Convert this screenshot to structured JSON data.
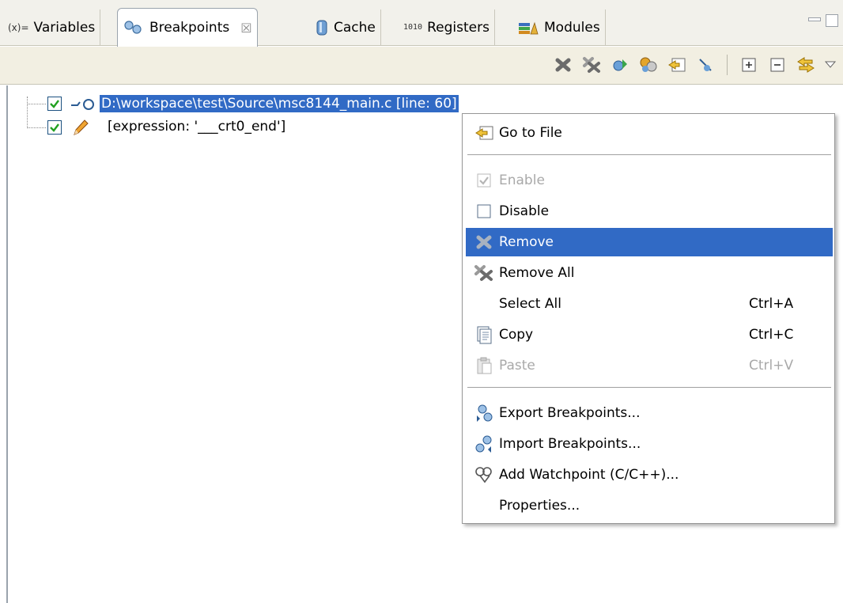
{
  "tabs": [
    {
      "icon": "variables-icon",
      "label": "Variables",
      "prefix": "(x)="
    },
    {
      "icon": "breakpoints-icon",
      "label": "Breakpoints",
      "close": "☒"
    },
    {
      "icon": "cache-icon",
      "label": "Cache"
    },
    {
      "icon": "registers-icon",
      "label": "Registers",
      "prefix": "1010"
    },
    {
      "icon": "modules-icon",
      "label": "Modules"
    }
  ],
  "toolbar": {
    "items": [
      "remove-icon",
      "remove-all-icon",
      "show-breakpoints-supported-icon",
      "skip-all-icon",
      "go-to-file-icon",
      "link-with-debug-view-icon",
      "expand-all-icon",
      "collapse-all-icon",
      "link-icon",
      "view-menu-icon"
    ]
  },
  "tree": {
    "items": [
      {
        "checked": true,
        "label": "D:\\workspace\\test\\Source\\msc8144_main.c [line: 60]",
        "selected": true
      },
      {
        "checked": true,
        "label": "[expression: '___crt0_end']",
        "selected": false
      }
    ]
  },
  "menu": {
    "items": [
      {
        "label": "Go to File",
        "accel": "",
        "icon": "go-to-file-icon",
        "disabled": false,
        "highlighted": false
      },
      {
        "label": "Enable",
        "accel": "",
        "icon": "enable-check-icon",
        "disabled": true,
        "highlighted": false
      },
      {
        "label": "Disable",
        "accel": "",
        "icon": "disable-checkbox-icon",
        "disabled": false,
        "highlighted": false
      },
      {
        "label": "Remove",
        "accel": "",
        "icon": "remove-icon",
        "disabled": false,
        "highlighted": true
      },
      {
        "label": "Remove All",
        "accel": "",
        "icon": "remove-all-icon",
        "disabled": false,
        "highlighted": false
      },
      {
        "label": "Select All",
        "accel": "Ctrl+A",
        "icon": "",
        "disabled": false,
        "highlighted": false
      },
      {
        "label": "Copy",
        "accel": "Ctrl+C",
        "icon": "copy-icon",
        "disabled": false,
        "highlighted": false
      },
      {
        "label": "Paste",
        "accel": "Ctrl+V",
        "icon": "paste-icon",
        "disabled": true,
        "highlighted": false
      },
      {
        "label": "Export Breakpoints...",
        "accel": "",
        "icon": "export-breakpoints-icon",
        "disabled": false,
        "highlighted": false
      },
      {
        "label": "Import Breakpoints...",
        "accel": "",
        "icon": "import-breakpoints-icon",
        "disabled": false,
        "highlighted": false
      },
      {
        "label": "Add Watchpoint (C/C++)...",
        "accel": "",
        "icon": "add-watchpoint-icon",
        "disabled": false,
        "highlighted": false
      },
      {
        "label": "Properties...",
        "accel": "",
        "icon": "",
        "disabled": false,
        "highlighted": false
      }
    ]
  },
  "colors": {
    "selection": "#316ac5",
    "tabbar_bg": "#f2f1eb",
    "toolbar_bg": "#f2efe2"
  }
}
